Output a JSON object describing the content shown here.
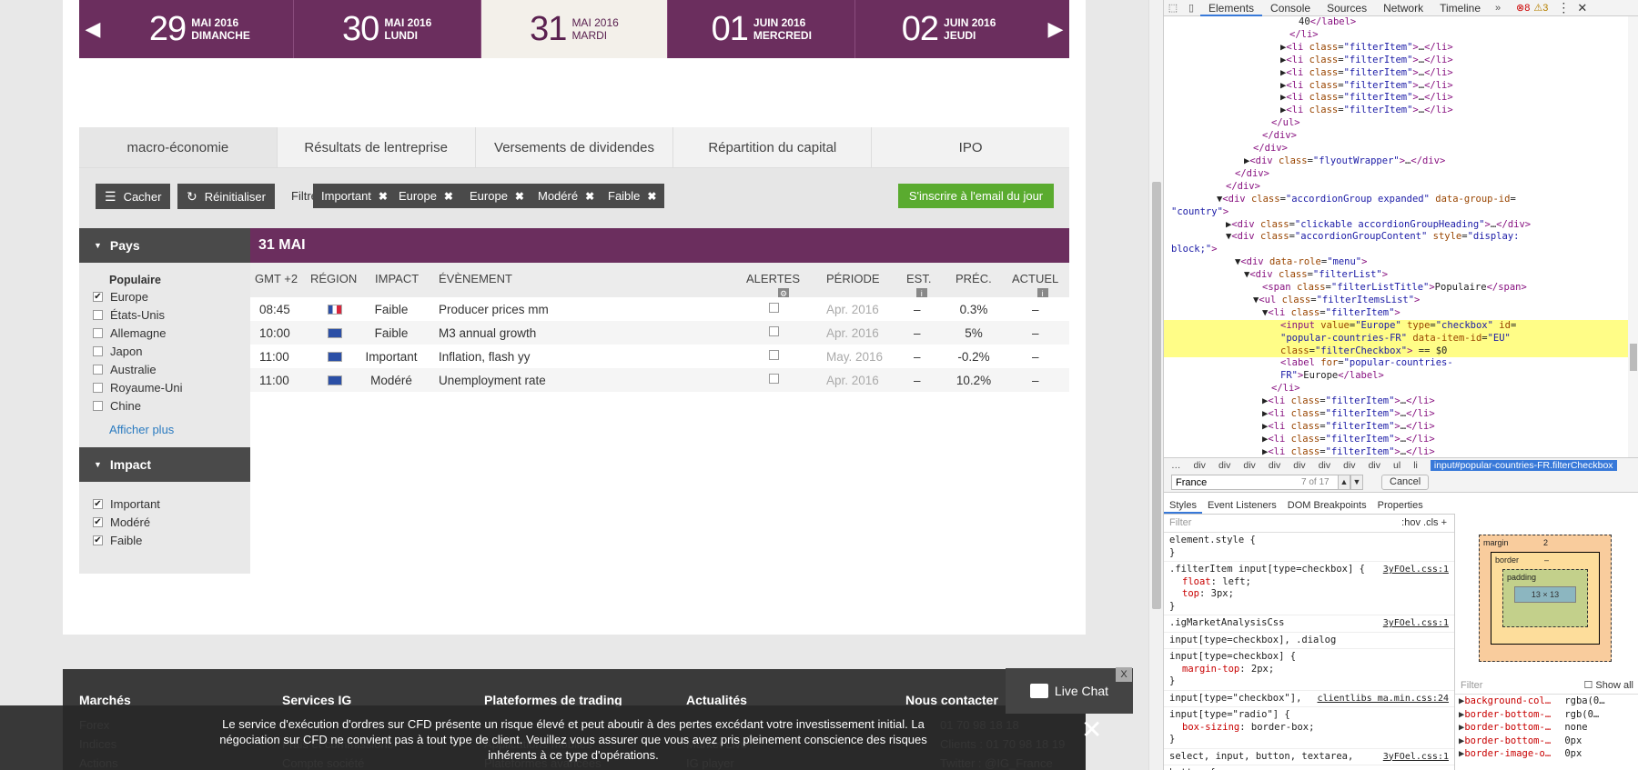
{
  "dates": [
    {
      "num": "29",
      "month": "MAI 2016",
      "weekday": "DIMANCHE",
      "active": false
    },
    {
      "num": "30",
      "month": "MAI 2016",
      "weekday": "LUNDI",
      "active": false
    },
    {
      "num": "31",
      "month": "MAI 2016",
      "weekday": "MARDI",
      "active": true
    },
    {
      "num": "01",
      "month": "JUIN 2016",
      "weekday": "MERCREDI",
      "active": false
    },
    {
      "num": "02",
      "month": "JUIN 2016",
      "weekday": "JEUDI",
      "active": false
    }
  ],
  "tabs": [
    "macro-économie",
    "Résultats de lentreprise",
    "Versements de dividendes",
    "Répartition du capital",
    "IPO"
  ],
  "filterbar": {
    "hide_label": "Cacher",
    "reset_label": "Réinitialiser",
    "filter_by": "Filtrer par :",
    "chips": [
      "Important",
      "Europe",
      "Europe",
      "Modéré",
      "Faible"
    ],
    "subscribe_label": "S'inscrire à l'email du jour"
  },
  "sidebar": {
    "country_heading": "Pays",
    "popular_title": "Populaire",
    "countries": [
      {
        "label": "Europe",
        "checked": true
      },
      {
        "label": "États-Unis",
        "checked": false
      },
      {
        "label": "Allemagne",
        "checked": false
      },
      {
        "label": "Japon",
        "checked": false
      },
      {
        "label": "Australie",
        "checked": false
      },
      {
        "label": "Royaume-Uni",
        "checked": false
      },
      {
        "label": "Chine",
        "checked": false
      }
    ],
    "show_more": "Afficher plus",
    "impact_heading": "Impact",
    "impacts": [
      {
        "label": "Important",
        "checked": true
      },
      {
        "label": "Modéré",
        "checked": true
      },
      {
        "label": "Faible",
        "checked": true
      }
    ]
  },
  "events": {
    "date_heading": "31 MAI",
    "columns": {
      "time": "GMT +2",
      "region": "RÉGION",
      "impact": "IMPACT",
      "event": "ÉVÈNEMENT",
      "alerts": "ALERTES",
      "period": "PÉRIODE",
      "est": "EST.",
      "prev": "PRÉC.",
      "actual": "ACTUEL"
    },
    "rows": [
      {
        "time": "08:45",
        "flag": "fr",
        "impact": "Faible",
        "event": "Producer prices mm",
        "period": "Apr. 2016",
        "est": "–",
        "prev": "0.3%",
        "actual": "–"
      },
      {
        "time": "10:00",
        "flag": "eu",
        "impact": "Faible",
        "event": "M3 annual growth",
        "period": "Apr. 2016",
        "est": "–",
        "prev": "5%",
        "actual": "–"
      },
      {
        "time": "11:00",
        "flag": "eu",
        "impact": "Important",
        "event": "Inflation, flash yy",
        "period": "May. 2016",
        "est": "–",
        "prev": "-0.2%",
        "actual": "–"
      },
      {
        "time": "11:00",
        "flag": "eu",
        "impact": "Modéré",
        "event": "Unemployment rate",
        "period": "Apr. 2016",
        "est": "–",
        "prev": "10.2%",
        "actual": "–"
      }
    ]
  },
  "footer": {
    "columns": [
      {
        "title": "Marchés",
        "links": [
          "Forex",
          "Indices",
          "Actions"
        ]
      },
      {
        "title": "Services IG",
        "links": [
          "",
          "Frais et commissions",
          "Compte société"
        ]
      },
      {
        "title": "Plateformes de trading",
        "links": [
          "",
          "Applications mobiles",
          "Plateformes avancées"
        ]
      },
      {
        "title": "Actualités",
        "links": [
          "",
          "Market Live",
          "IG player"
        ]
      },
      {
        "title": "Nous contacter",
        "links": [
          "01 70 98 18 18",
          "Clients : 01 70 98 18 19",
          "Twitter : @IG_France"
        ]
      }
    ],
    "cookie_text": "Le service d'exécution d'ordres sur CFD présente un risque élevé et peut aboutir à des pertes excédant votre investissement initial. La négociation sur CFD ne convient pas à tout type de client. Veuillez vous assurer que vous avez pris pleinement conscience des risques inhérents à ce type d'opérations.",
    "live_chat": "Live Chat"
  },
  "devtools": {
    "tabs": [
      "Elements",
      "Console",
      "Sources",
      "Network",
      "Timeline"
    ],
    "errors": "8",
    "warnings": "3",
    "dom_lines": [
      {
        "indent": 14,
        "html": "<span class='tx'>40</span><span class='tg'>&lt;/label&gt;</span>"
      },
      {
        "indent": 13,
        "html": "<span class='tg'>&lt;/li&gt;</span>"
      },
      {
        "indent": 12,
        "html": "▶<span class='tg'>&lt;li</span> <span class='at'>class</span>=<span class='av'>\"filterItem\"</span><span class='tg'>&gt;</span>…<span class='tg'>&lt;/li&gt;</span>"
      },
      {
        "indent": 12,
        "html": "▶<span class='tg'>&lt;li</span> <span class='at'>class</span>=<span class='av'>\"filterItem\"</span><span class='tg'>&gt;</span>…<span class='tg'>&lt;/li&gt;</span>"
      },
      {
        "indent": 12,
        "html": "▶<span class='tg'>&lt;li</span> <span class='at'>class</span>=<span class='av'>\"filterItem\"</span><span class='tg'>&gt;</span>…<span class='tg'>&lt;/li&gt;</span>"
      },
      {
        "indent": 12,
        "html": "▶<span class='tg'>&lt;li</span> <span class='at'>class</span>=<span class='av'>\"filterItem\"</span><span class='tg'>&gt;</span>…<span class='tg'>&lt;/li&gt;</span>"
      },
      {
        "indent": 12,
        "html": "▶<span class='tg'>&lt;li</span> <span class='at'>class</span>=<span class='av'>\"filterItem\"</span><span class='tg'>&gt;</span>…<span class='tg'>&lt;/li&gt;</span>"
      },
      {
        "indent": 12,
        "html": "▶<span class='tg'>&lt;li</span> <span class='at'>class</span>=<span class='av'>\"filterItem\"</span><span class='tg'>&gt;</span>…<span class='tg'>&lt;/li&gt;</span>"
      },
      {
        "indent": 11,
        "html": "<span class='tg'>&lt;/ul&gt;</span>"
      },
      {
        "indent": 10,
        "html": "<span class='tg'>&lt;/div&gt;</span>"
      },
      {
        "indent": 9,
        "html": "<span class='tg'>&lt;/div&gt;</span>"
      },
      {
        "indent": 8,
        "html": "▶<span class='tg'>&lt;div</span> <span class='at'>class</span>=<span class='av'>\"flyoutWrapper\"</span><span class='tg'>&gt;</span>…<span class='tg'>&lt;/div&gt;</span>"
      },
      {
        "indent": 7,
        "html": "<span class='tg'>&lt;/div&gt;</span>"
      },
      {
        "indent": 6,
        "html": "<span class='tg'>&lt;/div&gt;</span>"
      },
      {
        "indent": 5,
        "html": "▼<span class='tg'>&lt;div</span> <span class='at'>class</span>=<span class='av'>\"accordionGroup expanded\"</span> <span class='at'>data-group-id</span>="
      },
      {
        "indent": 0,
        "html": "<span class='av'>\"country\"</span><span class='tg'>&gt;</span>"
      },
      {
        "indent": 6,
        "html": "▶<span class='tg'>&lt;div</span> <span class='at'>class</span>=<span class='av'>\"clickable accordionGroupHeading\"</span><span class='tg'>&gt;</span>…<span class='tg'>&lt;/div&gt;</span>"
      },
      {
        "indent": 6,
        "html": "▼<span class='tg'>&lt;div</span> <span class='at'>class</span>=<span class='av'>\"accordionGroupContent\"</span> <span class='at'>style</span>=<span class='av'>\"display:</span>"
      },
      {
        "indent": 0,
        "html": "<span class='av'>block;\"</span><span class='tg'>&gt;</span>"
      },
      {
        "indent": 7,
        "html": "▼<span class='tg'>&lt;div</span> <span class='at'>data-role</span>=<span class='av'>\"menu\"</span><span class='tg'>&gt;</span>"
      },
      {
        "indent": 8,
        "html": "▼<span class='tg'>&lt;div</span> <span class='at'>class</span>=<span class='av'>\"filterList\"</span><span class='tg'>&gt;</span>"
      },
      {
        "indent": 10,
        "html": "<span class='tg'>&lt;span</span> <span class='at'>class</span>=<span class='av'>\"filterListTitle\"</span><span class='tg'>&gt;</span>Populaire<span class='tg'>&lt;/span&gt;</span>"
      },
      {
        "indent": 9,
        "html": "▼<span class='tg'>&lt;ul</span> <span class='at'>class</span>=<span class='av'>\"filterItemsList\"</span><span class='tg'>&gt;</span>"
      },
      {
        "indent": 10,
        "html": "▼<span class='tg'>&lt;li</span> <span class='at'>class</span>=<span class='av'>\"filterItem\"</span><span class='tg'>&gt;</span>"
      },
      {
        "indent": 12,
        "sel": true,
        "html": "<span class='tg'>&lt;input</span> <span class='at'>value</span>=<span class='av'>\"Europe\"</span> <span class='at'>type</span>=<span class='av'>\"checkbox\"</span> <span class='at'>id</span>="
      },
      {
        "indent": 12,
        "sel": true,
        "html": "<span class='av'>\"popular-countries-FR\"</span> <span class='at'>data-item-id</span>=<span class='av'>\"EU\"</span>"
      },
      {
        "indent": 12,
        "sel": true,
        "html": "<span class='at'>class</span>=<span class='av'>\"filterCheckbox\"</span><span class='tg'>&gt;</span> == $0"
      },
      {
        "indent": 12,
        "html": "<span class='tg'>&lt;label</span> <span class='at'>for</span>=<span class='av'>\"popular-countries-</span>"
      },
      {
        "indent": 12,
        "html": "<span class='av'>FR\"</span><span class='tg'>&gt;</span>Europe<span class='tg'>&lt;/label&gt;</span>"
      },
      {
        "indent": 11,
        "html": "<span class='tg'>&lt;/li&gt;</span>"
      },
      {
        "indent": 10,
        "html": "▶<span class='tg'>&lt;li</span> <span class='at'>class</span>=<span class='av'>\"filterItem\"</span><span class='tg'>&gt;</span>…<span class='tg'>&lt;/li&gt;</span>"
      },
      {
        "indent": 10,
        "html": "▶<span class='tg'>&lt;li</span> <span class='at'>class</span>=<span class='av'>\"filterItem\"</span><span class='tg'>&gt;</span>…<span class='tg'>&lt;/li&gt;</span>"
      },
      {
        "indent": 10,
        "html": "▶<span class='tg'>&lt;li</span> <span class='at'>class</span>=<span class='av'>\"filterItem\"</span><span class='tg'>&gt;</span>…<span class='tg'>&lt;/li&gt;</span>"
      },
      {
        "indent": 10,
        "html": "▶<span class='tg'>&lt;li</span> <span class='at'>class</span>=<span class='av'>\"filterItem\"</span><span class='tg'>&gt;</span>…<span class='tg'>&lt;/li&gt;</span>"
      },
      {
        "indent": 10,
        "html": "▶<span class='tg'>&lt;li</span> <span class='at'>class</span>=<span class='av'>\"filterItem\"</span><span class='tg'>&gt;</span>…<span class='tg'>&lt;/li&gt;</span>"
      }
    ],
    "breadcrumbs": [
      "…",
      "div",
      "div",
      "div",
      "div",
      "div",
      "div",
      "div",
      "div",
      "ul",
      "li"
    ],
    "breadcrumb_selected": "input#popular-countries-FR.filterCheckbox",
    "search": {
      "value": "France",
      "count": "7 of 17",
      "cancel": "Cancel"
    },
    "panel_tabs": [
      "Styles",
      "Event Listeners",
      "DOM Breakpoints",
      "Properties"
    ],
    "styles_filter": "Filter",
    "styles_toggles": ":hov   .cls   +",
    "style_rules": [
      {
        "selector": "element.style {",
        "source": "",
        "props": [],
        "end": "}"
      },
      {
        "selector": ".filterItem input[type=checkbox] {",
        "source": "3yFOel.css:1",
        "props": [
          {
            "name": "float",
            "value": "left;"
          },
          {
            "name": "top",
            "value": "3px;"
          }
        ],
        "end": "}"
      },
      {
        "selector": ".igMarketAnalysisCss",
        "source": "3yFOel.css:1",
        "props": [],
        "end": ""
      },
      {
        "selector": "input[type=checkbox], .dialog",
        "source": "",
        "props": [],
        "end": ""
      },
      {
        "selector": "input[type=checkbox] {",
        "source": "",
        "props": [
          {
            "name": "margin-top",
            "value": "2px;"
          }
        ],
        "end": "}"
      },
      {
        "selector": "input[type=\"checkbox\"],",
        "source": "clientlibs ma.min.css:24",
        "props": [],
        "end": ""
      },
      {
        "selector": "input[type=\"radio\"] {",
        "source": "",
        "props": [
          {
            "name": "box-sizing",
            "value": "border-box;"
          }
        ],
        "end": "}"
      },
      {
        "selector": "select, input, button, textarea,",
        "source": "3yFOel.css:1",
        "props": [],
        "end": ""
      },
      {
        "selector": "button {",
        "source": "",
        "props": [],
        "end": ""
      }
    ],
    "boxmodel": {
      "margin": "margin",
      "margin_top": "2",
      "border": "border",
      "padding": "padding",
      "content": "13 × 13",
      "dash": "–"
    },
    "computed_filter": "Filter",
    "show_all": "Show all",
    "computed": [
      {
        "name": "background-col…",
        "value": "rgba(0…"
      },
      {
        "name": "border-bottom-…",
        "value": "rgb(0…"
      },
      {
        "name": "border-bottom-…",
        "value": "none"
      },
      {
        "name": "border-bottom-…",
        "value": "0px"
      },
      {
        "name": "border-image-o…",
        "value": "0px"
      }
    ]
  }
}
